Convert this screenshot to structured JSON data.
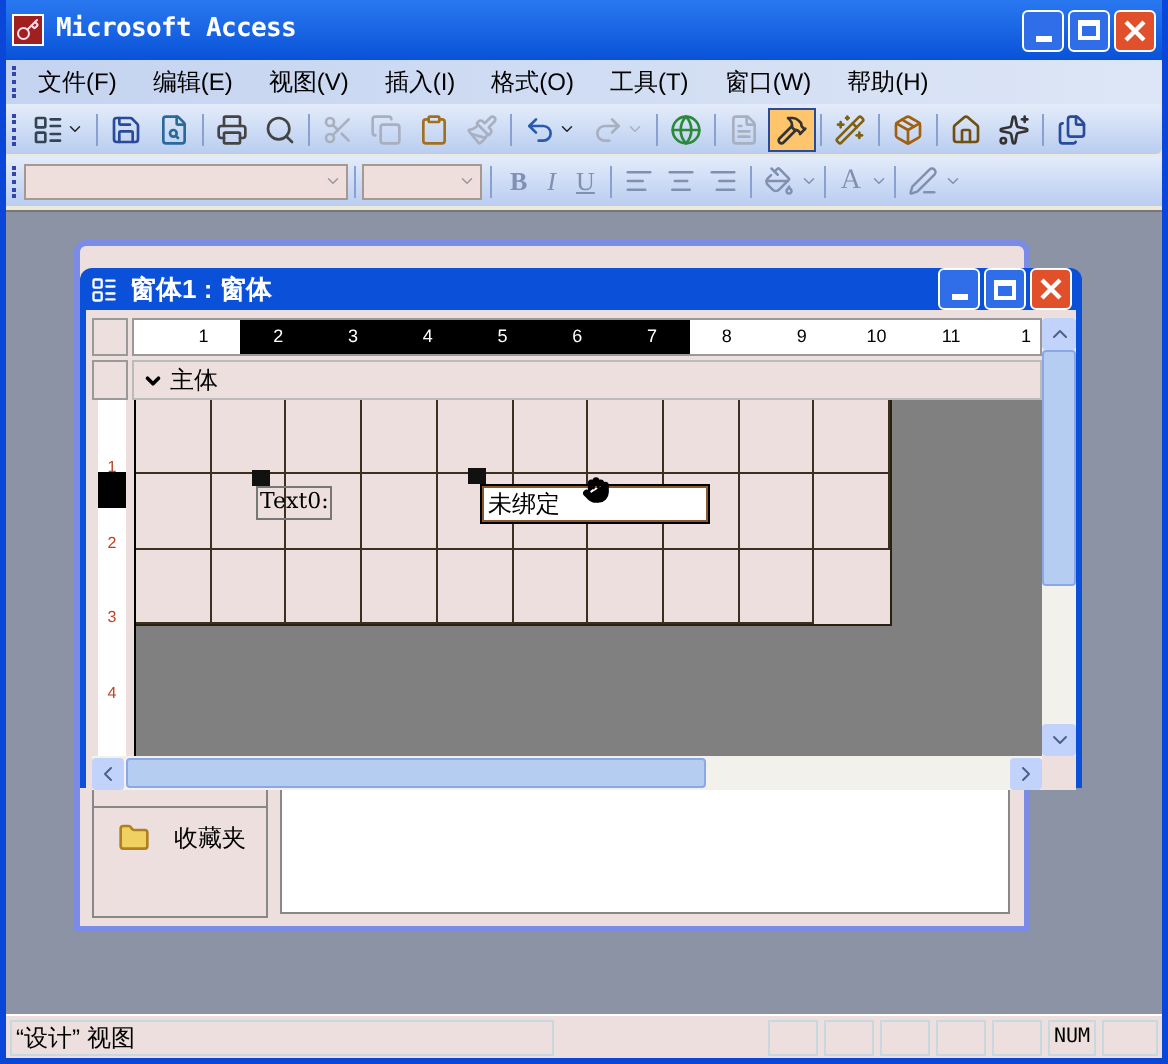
{
  "app": {
    "title": "Microsoft Access"
  },
  "menu": [
    {
      "label": "文件(F)"
    },
    {
      "label": "编辑(E)"
    },
    {
      "label": "视图(V)"
    },
    {
      "label": "插入(I)"
    },
    {
      "label": "格式(O)"
    },
    {
      "label": "工具(T)"
    },
    {
      "label": "窗口(W)"
    },
    {
      "label": "帮助(H)"
    }
  ],
  "standard_toolbar": [
    {
      "kind": "view",
      "disabled": false,
      "pressed": false
    },
    {
      "kind": "separator"
    },
    {
      "kind": "save",
      "disabled": false,
      "pressed": false
    },
    {
      "kind": "search-file",
      "disabled": false,
      "pressed": false
    },
    {
      "kind": "separator"
    },
    {
      "kind": "print",
      "disabled": false,
      "pressed": false
    },
    {
      "kind": "preview",
      "disabled": false,
      "pressed": false
    },
    {
      "kind": "separator"
    },
    {
      "kind": "cut",
      "disabled": true,
      "pressed": false
    },
    {
      "kind": "copy",
      "disabled": true,
      "pressed": false
    },
    {
      "kind": "paste",
      "disabled": false,
      "pressed": false
    },
    {
      "kind": "brush",
      "disabled": true,
      "pressed": false
    },
    {
      "kind": "separator"
    },
    {
      "kind": "undo",
      "disabled": false,
      "pressed": false
    },
    {
      "kind": "redo",
      "disabled": true,
      "pressed": false
    },
    {
      "kind": "separator"
    },
    {
      "kind": "globe",
      "disabled": false,
      "pressed": false
    },
    {
      "kind": "separator"
    },
    {
      "kind": "list",
      "disabled": true,
      "pressed": false
    },
    {
      "kind": "toolbox",
      "disabled": false,
      "pressed": true
    },
    {
      "kind": "separator"
    },
    {
      "kind": "wand",
      "disabled": false,
      "pressed": false
    },
    {
      "kind": "separator"
    },
    {
      "kind": "build",
      "disabled": false,
      "pressed": false
    },
    {
      "kind": "separator"
    },
    {
      "kind": "home",
      "disabled": false,
      "pressed": false
    },
    {
      "kind": "sparkle",
      "disabled": false,
      "pressed": false
    },
    {
      "kind": "separator"
    },
    {
      "kind": "windows",
      "disabled": false,
      "pressed": false
    }
  ],
  "format_toolbar": {
    "bold": "B",
    "italic": "I",
    "underline": "U",
    "font_color": "A"
  },
  "database_window": {
    "nav": [
      {
        "label": "收藏夹"
      }
    ]
  },
  "form_window": {
    "title": "窗体1 : 窗体",
    "section": "主体",
    "ruler": [
      {
        "label": "1",
        "highlighted": false
      },
      {
        "label": "2",
        "highlighted": true
      },
      {
        "label": "3",
        "highlighted": true
      },
      {
        "label": "4",
        "highlighted": true
      },
      {
        "label": "5",
        "highlighted": true
      },
      {
        "label": "6",
        "highlighted": true
      },
      {
        "label": "7",
        "highlighted": true
      },
      {
        "label": "8",
        "highlighted": false
      },
      {
        "label": "9",
        "highlighted": false
      },
      {
        "label": "10",
        "highlighted": false
      },
      {
        "label": "11",
        "highlighted": false
      },
      {
        "label": "1",
        "highlighted": false
      }
    ],
    "vertical_ruler": [
      {
        "label": "1",
        "highlighted": true
      },
      {
        "label": "2",
        "highlighted": false
      },
      {
        "label": "3",
        "highlighted": false
      },
      {
        "label": "4",
        "highlighted": false
      }
    ],
    "controls": [
      {
        "kind": "label",
        "text": "Text0:",
        "selected": false
      },
      {
        "kind": "textbox",
        "text": "未绑定",
        "selected": true
      }
    ]
  },
  "status_bar": {
    "text": "“设计” 视图",
    "indicator": "NUM"
  }
}
